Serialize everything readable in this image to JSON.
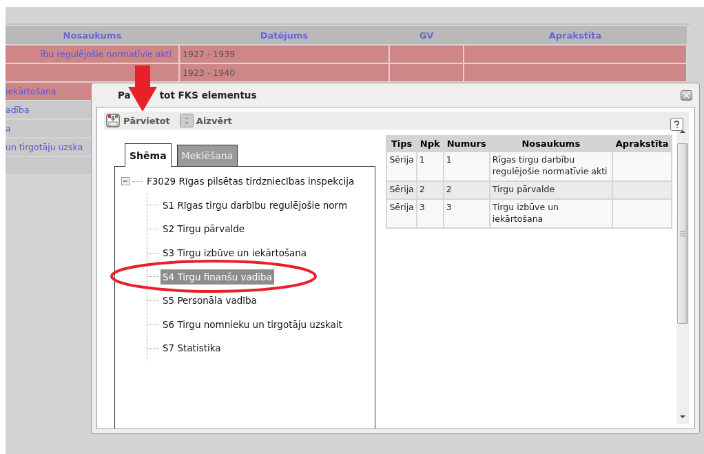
{
  "background_table": {
    "columns": [
      "Nosaukums",
      "Datējums",
      "GV",
      "Aprakstīta"
    ],
    "rows": [
      {
        "name": "ību regulējošie normatīvie akti",
        "dating": "1927 - 1939",
        "highlighted": true
      },
      {
        "dating": "1923 - 1940",
        "highlighted": true
      },
      {
        "name": "iekārtošana",
        "highlighted": true
      },
      {
        "name": "adība",
        "highlighted": false
      },
      {
        "name": "a",
        "highlighted": false
      },
      {
        "name": "un tirgotāju uzska",
        "highlighted": false
      },
      {
        "highlighted": false
      }
    ]
  },
  "dialog": {
    "title_parts": [
      "Pa",
      "tot FKS elementus"
    ],
    "toolbar": [
      {
        "label": "Pārvietot",
        "kind": "move"
      },
      {
        "label": "Aizvērt",
        "kind": "close"
      }
    ],
    "tabs": [
      {
        "label": "Shēma",
        "selected": true
      },
      {
        "label": "Meklēšana",
        "selected": false
      }
    ],
    "tree": {
      "label": "F3029 Rīgas pilsētas tirdzniecības inspekcija",
      "expanded": true,
      "selected": false,
      "children": [
        {
          "label": "S1 Rīgas tirgu darbību regulējošie norm",
          "selected": false
        },
        {
          "label": "S2 Tirgu pārvalde",
          "selected": false
        },
        {
          "label": "S3 Tirgu izbūve un iekārtošana",
          "selected": false
        },
        {
          "label": "S4 Tirgu finanšu vadība",
          "selected": true
        },
        {
          "label": "S5 Personāla vadība",
          "selected": false
        },
        {
          "label": "S6 Tirgu nomnieku un tirgotāju uzskait",
          "selected": false
        },
        {
          "label": "S7 Statistika",
          "selected": false
        }
      ]
    },
    "table": {
      "columns": [
        "Tips",
        "Npk",
        "Numurs",
        "Nosaukums",
        "Aprakstīta"
      ],
      "rows": [
        {
          "cells": [
            "Sērija",
            "1",
            "1",
            "Rīgas tirgu darbību regulējošie normatīvie akti"
          ]
        },
        {
          "cells": [
            "Sērija",
            "2",
            "2",
            "Tirgu pārvalde"
          ]
        },
        {
          "cells": [
            "Sērija",
            "3",
            "3",
            "Tirgu izbūve un iekārtošana"
          ]
        }
      ]
    }
  }
}
